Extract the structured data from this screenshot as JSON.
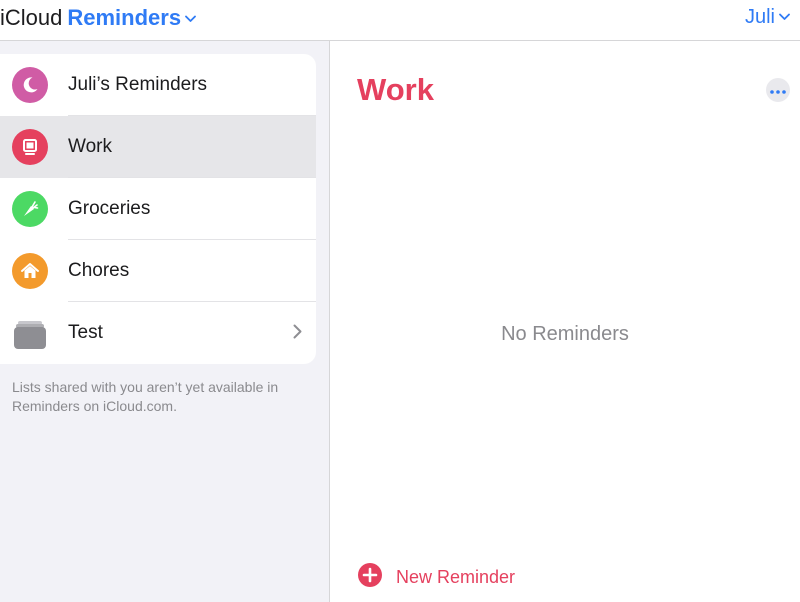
{
  "header": {
    "brand_prefix": "iCloud",
    "app_name": "Reminders",
    "user_name": "Juli"
  },
  "sidebar": {
    "items": [
      {
        "label": "Juli’s Reminders",
        "icon": "moon-icon",
        "color": "#d05ca5"
      },
      {
        "label": "Work",
        "icon": "monitor-icon",
        "color": "#e5405e",
        "selected": true
      },
      {
        "label": "Groceries",
        "icon": "carrot-icon",
        "color": "#4cd964"
      },
      {
        "label": "Chores",
        "icon": "house-icon",
        "color": "#f39a2c"
      },
      {
        "label": "Test",
        "icon": "stack-icon",
        "color": "#8e8e93"
      }
    ],
    "note": "Lists shared with you aren’t yet available in Reminders on iCloud.com."
  },
  "main": {
    "title": "Work",
    "empty_text": "No Reminders",
    "new_reminder_label": "New Reminder"
  },
  "colors": {
    "accent_blue": "#2f7bf5",
    "accent_red": "#e5405e"
  }
}
